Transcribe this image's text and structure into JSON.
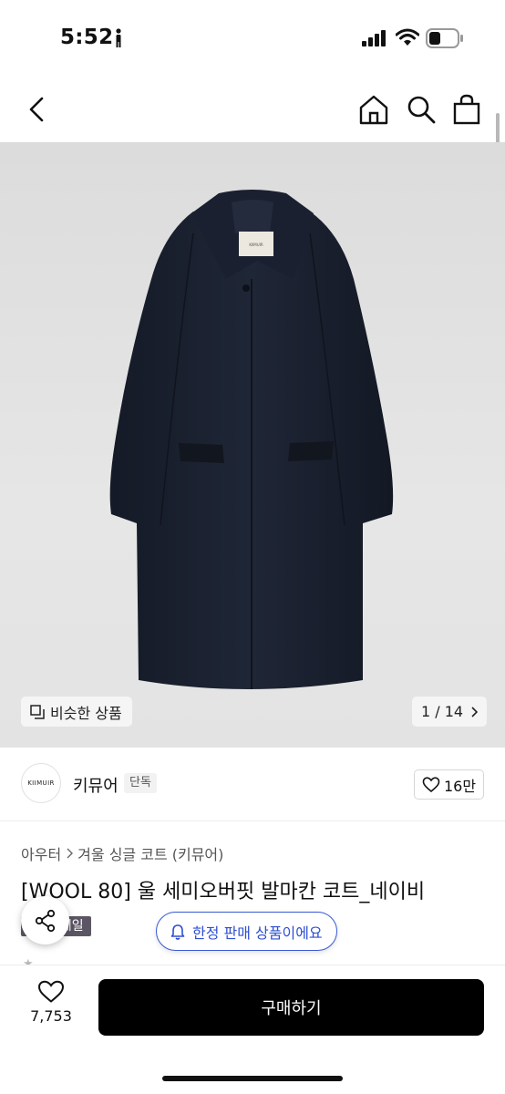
{
  "status_bar": {
    "time": "5:52"
  },
  "gallery": {
    "similar_label": "비슷한 상품",
    "counter": "1 / 14",
    "coat_label_text": "KIIMUIR"
  },
  "brand": {
    "logo_text": "KIIMUIR",
    "name": "키뮤어",
    "badge": "단독",
    "likes": "16만"
  },
  "breadcrumb": [
    "아우터",
    "겨울 싱글 코트 (키뮤어)"
  ],
  "product": {
    "title": "[WOOL 80] 울 세미오버핏 발마칸 코트_네이비",
    "sale_tag": "한세일"
  },
  "notice": {
    "text": "한정 판매 상품이에요"
  },
  "bottom": {
    "wish_count": "7,753",
    "buy_label": "구매하기"
  },
  "colors": {
    "accent": "#2f4fd0",
    "buy_bg": "#000000",
    "coat": "#1b2130"
  }
}
